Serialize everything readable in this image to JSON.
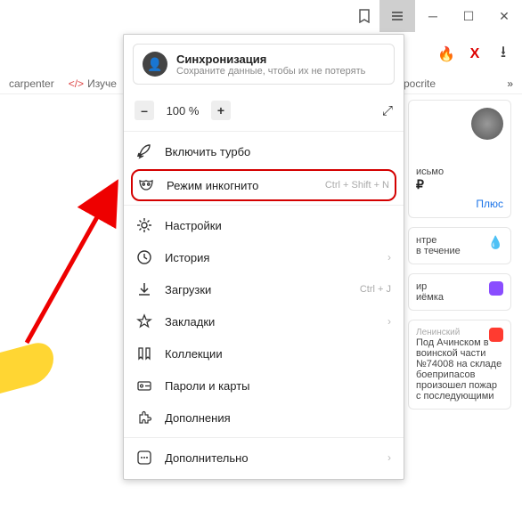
{
  "window": {
    "bookmark_icon": "⟐",
    "hamburger": "≡",
    "minimize": "─",
    "maximize": "☐",
    "close": "✕"
  },
  "extras": {
    "hot": "🔥",
    "x": "X",
    "download": "⭳"
  },
  "bookmarks": {
    "left_frag": "carpenter",
    "studysite": "Изуче",
    "right_frag": "ypocrite",
    "more": "»"
  },
  "menu": {
    "sync": {
      "title": "Синхронизация",
      "subtitle": "Сохраните данные, чтобы их не потерять",
      "avatar_glyph": "👤"
    },
    "zoom": {
      "minus": "–",
      "value": "100 %",
      "plus": "+",
      "fullscreen": "⤢"
    },
    "items": {
      "turbo": {
        "label": "Включить турбо"
      },
      "incognito": {
        "label": "Режим инкогнито",
        "shortcut": "Ctrl + Shift + N"
      },
      "settings": {
        "label": "Настройки"
      },
      "history": {
        "label": "История"
      },
      "downloads": {
        "label": "Загрузки",
        "shortcut": "Ctrl + J"
      },
      "favorites": {
        "label": "Закладки"
      },
      "collections": {
        "label": "Коллекции"
      },
      "passwords": {
        "label": "Пароли и карты"
      },
      "addons": {
        "label": "Дополнения"
      },
      "more": {
        "label": "Дополнительно"
      }
    }
  },
  "side": {
    "card1": {
      "line1": "исьмо",
      "money": "₽"
    },
    "card1_link": "Плюс",
    "card2": {
      "l1": "нтре",
      "l2": "в течение"
    },
    "card3": {
      "l1": "ир",
      "l2": "иёмка"
    },
    "card4": {
      "region": "Ленинский",
      "text": "Под Ачинском в воинской части №74008 на складе боеприпасов произошел пожар с последующими"
    }
  }
}
